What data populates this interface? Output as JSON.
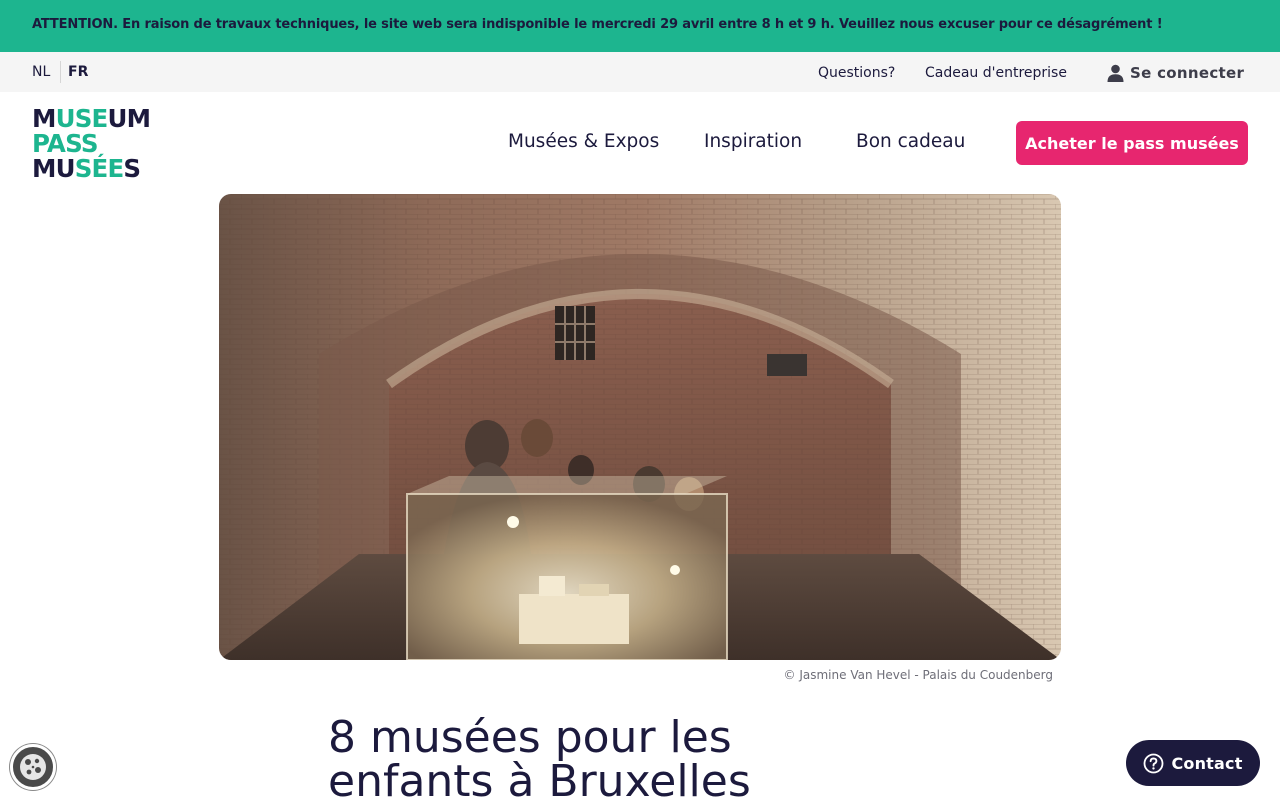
{
  "banner": {
    "text": "ATTENTION. En raison de travaux techniques, le site web sera indisponible le mercredi 29 avril entre 8 h et 9 h. Veuillez nous excuser pour ce désagrément !"
  },
  "topbar": {
    "languages": [
      "NL",
      "FR"
    ],
    "active_language": "FR",
    "links": [
      "Questions?",
      "Cadeau d'entreprise"
    ],
    "login_label": "Se connecter"
  },
  "logo": {
    "lines": [
      [
        {
          "text": "M",
          "tone": "dark"
        },
        {
          "text": "USE",
          "tone": "green"
        },
        {
          "text": "UM",
          "tone": "dark"
        }
      ],
      [
        {
          "text": "PASS",
          "tone": "green"
        }
      ],
      [
        {
          "text": "MU",
          "tone": "dark"
        },
        {
          "text": "SÉE",
          "tone": "green"
        },
        {
          "text": "S",
          "tone": "dark"
        }
      ]
    ]
  },
  "nav": {
    "items": [
      "Musées & Expos",
      "Inspiration",
      "Bon cadeau"
    ],
    "cta_label": "Acheter le pass musées"
  },
  "hero": {
    "credit": "© Jasmine Van Hevel - Palais du Coudenberg"
  },
  "article": {
    "title": "8 musées pour les enfants à Bruxelles"
  },
  "widgets": {
    "contact_label": "Contact",
    "cookie_icon": "cookie-icon",
    "help_icon": "question-circle-icon",
    "user_icon": "user-icon"
  },
  "colors": {
    "brand_green": "#1db58f",
    "brand_navy": "#1c1a3d",
    "cta_pink": "#e7266f"
  }
}
